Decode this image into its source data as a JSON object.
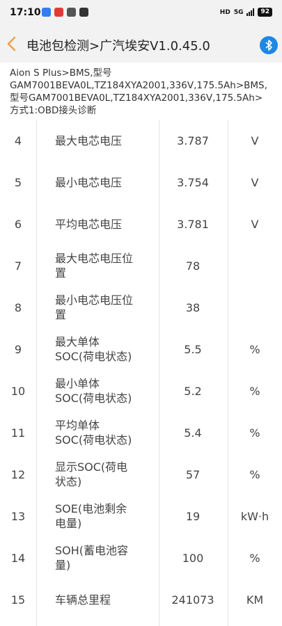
{
  "status_bar": {
    "time": "17:10",
    "network": "5G",
    "hd_label": "HD",
    "battery": "92"
  },
  "header": {
    "title": "电池包检测>广汽埃安V1.0.45.0",
    "back_icon": "chevron-left-icon",
    "bluetooth_icon": "bluetooth-icon"
  },
  "info": {
    "line1": "Aion S Plus>BMS,型号",
    "line2": "GAM7001BEVA0L,TZ184XYA2001,336V,175.5Ah>BMS,",
    "line3": "型号GAM7001BEVA0L,TZ184XYA2001,336V,175.5Ah>",
    "line4": "方式1:OBD接头诊断"
  },
  "table": {
    "rows": [
      {
        "no": "4",
        "name": [
          "最大电芯电压"
        ],
        "value": "3.787",
        "unit": "V"
      },
      {
        "no": "5",
        "name": [
          "最小电芯电压"
        ],
        "value": "3.754",
        "unit": "V"
      },
      {
        "no": "6",
        "name": [
          "平均电芯电压"
        ],
        "value": "3.781",
        "unit": "V"
      },
      {
        "no": "7",
        "name": [
          "最大电芯电压位",
          "置"
        ],
        "value": "78",
        "unit": ""
      },
      {
        "no": "8",
        "name": [
          "最小电芯电压位",
          "置"
        ],
        "value": "38",
        "unit": ""
      },
      {
        "no": "9",
        "name": [
          "最大单体",
          "SOC(荷电状态)"
        ],
        "value": "5.5",
        "unit": "%"
      },
      {
        "no": "10",
        "name": [
          "最小单体",
          "SOC(荷电状态)"
        ],
        "value": "5.2",
        "unit": "%"
      },
      {
        "no": "11",
        "name": [
          "平均单体",
          "SOC(荷电状态)"
        ],
        "value": "5.4",
        "unit": "%"
      },
      {
        "no": "12",
        "name": [
          "显示SOC(荷电",
          "状态)"
        ],
        "value": "57",
        "unit": "%"
      },
      {
        "no": "13",
        "name": [
          "SOE(电池剩余",
          "电量)"
        ],
        "value": "19",
        "unit": "kW·h"
      },
      {
        "no": "14",
        "name": [
          "SOH(蓄电池容",
          "量)"
        ],
        "value": "100",
        "unit": "%"
      },
      {
        "no": "15",
        "name": [
          "车辆总里程"
        ],
        "value": "241073",
        "unit": "KM"
      }
    ]
  },
  "colors": {
    "header_bg": "#f2f2f2",
    "accent": "#f0a04b",
    "bluetooth": "#1e88e5"
  }
}
